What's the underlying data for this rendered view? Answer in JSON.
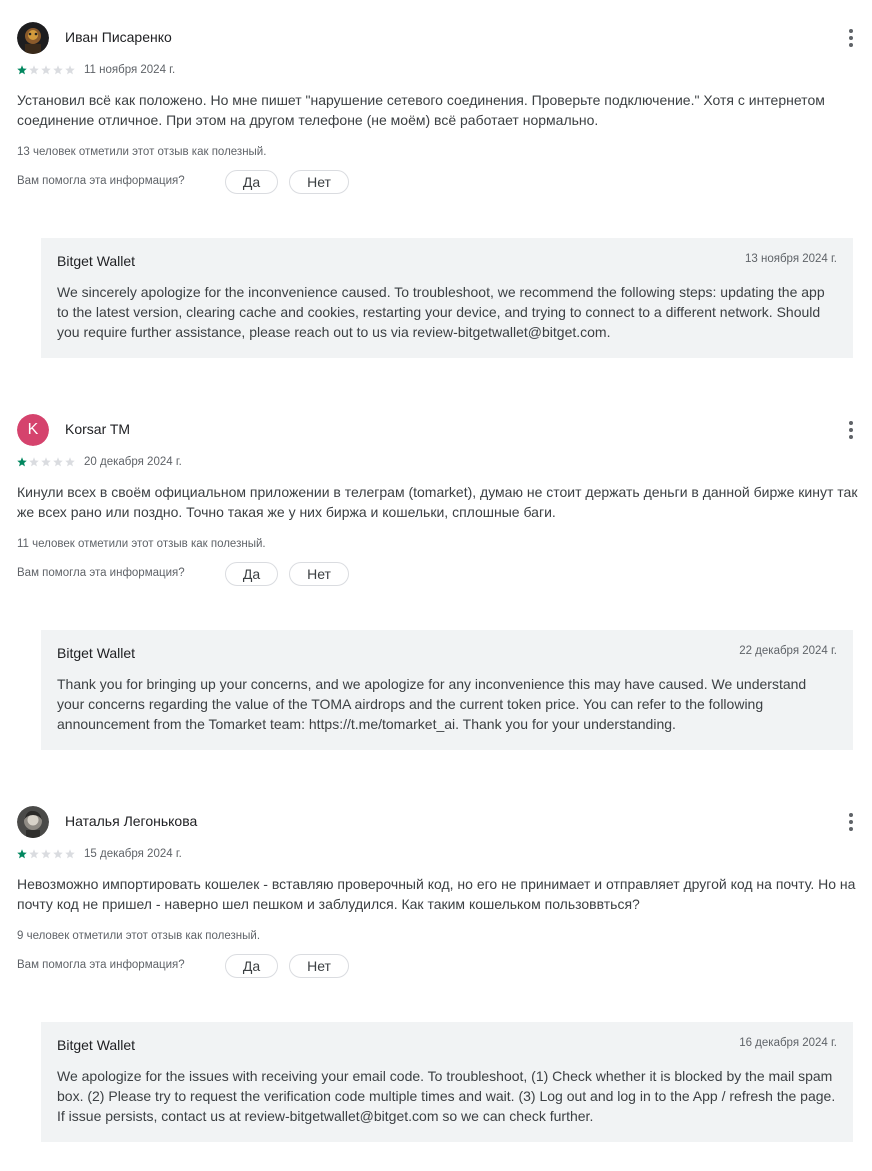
{
  "reviews": [
    {
      "author": "Иван Писаренко",
      "avatar": {
        "type": "photo",
        "icon": "user-photo-icon"
      },
      "rating": 1,
      "rating_max": 5,
      "date": "11 ноября 2024 г.",
      "text": "Установил всё как положено. Но мне пишет \"нарушение сетевого соединения. Проверьте подключение.\" Хотя с интернетом соединение отличное. При этом на другом телефоне (не моём) всё работает нормально.",
      "helpful_count_text": "13 человек отметили этот отзыв как полезный.",
      "helpful_question": "Вам помогла эта информация?",
      "yes_label": "Да",
      "no_label": "Нет",
      "more_icon": "more-vert-icon",
      "reply": {
        "author": "Bitget Wallet",
        "date": "13 ноября 2024 г.",
        "text": "We sincerely apologize for the inconvenience caused. To troubleshoot, we recommend the following steps: updating the app to the latest version, clearing cache and cookies, restarting your device, and trying to connect to a different network. Should you require further assistance, please reach out to us via review-bitgetwallet@bitget.com."
      }
    },
    {
      "author": "Korsar TM",
      "avatar": {
        "type": "letter",
        "letter": "K",
        "color": "#d5436d"
      },
      "rating": 1,
      "rating_max": 5,
      "date": "20 декабря 2024 г.",
      "text": "Кинули всех в своём официальном приложении в телеграм (tomarket), думаю не стоит держать деньги в данной бирже кинут так же всех рано или поздно. Точно такая же у них биржа и кошельки, сплошные баги.",
      "helpful_count_text": "11 человек отметили этот отзыв как полезный.",
      "helpful_question": "Вам помогла эта информация?",
      "yes_label": "Да",
      "no_label": "Нет",
      "more_icon": "more-vert-icon",
      "reply": {
        "author": "Bitget Wallet",
        "date": "22 декабря 2024 г.",
        "text": "Thank you for bringing up your concerns, and we apologize for any inconvenience this may have caused. We understand your concerns regarding the value of the TOMA airdrops and the current token price. You can refer to the following announcement from the Tomarket team: https://t.me/tomarket_ai. Thank you for your understanding."
      }
    },
    {
      "author": "Наталья Легонькова",
      "avatar": {
        "type": "photo",
        "icon": "user-photo-icon"
      },
      "rating": 1,
      "rating_max": 5,
      "date": "15 декабря 2024 г.",
      "text": "Невозможно импортировать кошелек - вставляю проверочный код, но его не принимает и отправляет другой код на почту. Но на почту код не пришел - наверно шел пешком и заблудился. Как таким кошельком пользоввться?",
      "helpful_count_text": "9 человек отметили этот отзыв как полезный.",
      "helpful_question": "Вам помогла эта информация?",
      "yes_label": "Да",
      "no_label": "Нет",
      "more_icon": "more-vert-icon",
      "reply": {
        "author": "Bitget Wallet",
        "date": "16 декабря 2024 г.",
        "text": "We apologize for the issues with receiving your email code. To troubleshoot, (1) Check whether it is blocked by the mail spam box. (2) Please try to request the verification code multiple times and wait. (3) Log out and log in to the App / refresh the page. If issue persists, contact us at review-bitgetwallet@bitget.com so we can check further."
      }
    }
  ],
  "colors": {
    "star_filled": "#01875f",
    "star_empty": "#dadce0",
    "reply_background": "#f1f3f4",
    "letter_avatar": "#d5436d"
  }
}
